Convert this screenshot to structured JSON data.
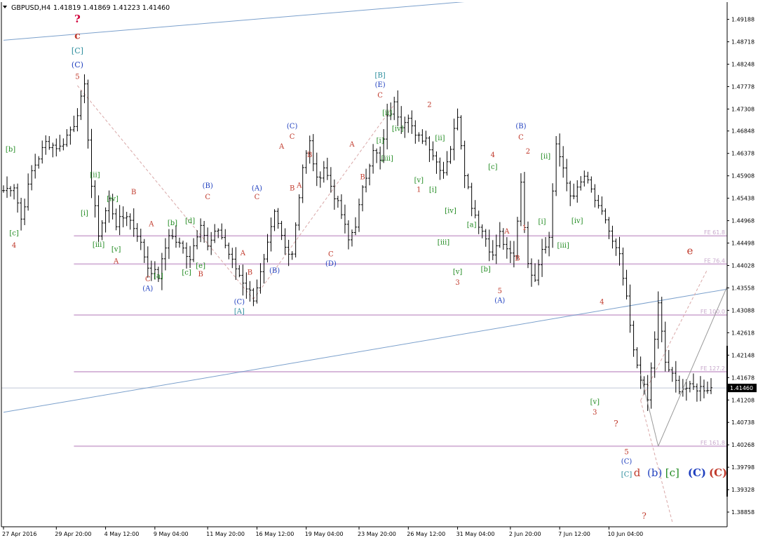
{
  "colors": {
    "background": "#ffffff",
    "bars": "#000000",
    "fib_lines": "#d7b8da",
    "fib_label": "#c8a9cc",
    "channel": "#7ba0cc",
    "red": "#c0392b",
    "magenta": "#d0003a",
    "green": "#228b22",
    "teal": "#2a8c9c",
    "blue": "#1f3fbf",
    "price_tag_bg": "#000000",
    "price_tag_text": "#ffffff",
    "dashed": "#d9a8a8",
    "projection": "#999999"
  },
  "chart_data": {
    "type": "ohlc",
    "header": {
      "symbol": "GBPUSD,H4",
      "ohlc": "1.41819 1.41869 1.41223 1.41460"
    },
    "ylim": [
      1.3855,
      1.4955
    ],
    "bar_count": 202,
    "x_tick_labels": [
      {
        "index": 0,
        "label": "27 Apr 2016"
      },
      {
        "index": 15,
        "label": "29 Apr 20:00"
      },
      {
        "index": 29,
        "label": "4 May 12:00"
      },
      {
        "index": 43,
        "label": "9 May 04:00"
      },
      {
        "index": 58,
        "label": "11 May 20:00"
      },
      {
        "index": 72,
        "label": "16 May 12:00"
      },
      {
        "index": 86,
        "label": "19 May 04:00"
      },
      {
        "index": 101,
        "label": "23 May 20:00"
      },
      {
        "index": 115,
        "label": "26 May 12:00"
      },
      {
        "index": 129,
        "label": "31 May 04:00"
      },
      {
        "index": 144,
        "label": "2 Jun 20:00"
      },
      {
        "index": 158,
        "label": "7 Jun 12:00"
      },
      {
        "index": 172,
        "label": "10 Jun 04:00"
      }
    ],
    "y_tick_labels": [
      "1.49188",
      "1.48718",
      "1.48248",
      "1.47778",
      "1.47308",
      "1.46848",
      "1.46378",
      "1.45908",
      "1.45438",
      "1.44968",
      "1.44498",
      "1.44028",
      "1.43558",
      "1.43088",
      "1.42618",
      "1.42148",
      "1.41678",
      "1.41208",
      "1.40738",
      "1.40268",
      "1.39798",
      "1.39328",
      "1.38858"
    ],
    "current_price": {
      "label": "1.41460",
      "value": 1.4146
    },
    "fib_levels": [
      {
        "label": "FE 61.8",
        "value": 1.4465
      },
      {
        "label": "FE 76.4",
        "value": 1.4406
      },
      {
        "label": "FE 100.0",
        "value": 1.4299
      },
      {
        "label": "FE 127.2",
        "value": 1.418
      },
      {
        "label": "FE 161.8",
        "value": 1.4024
      }
    ],
    "channel_lines": [
      {
        "from": [
          0,
          1.4875
        ],
        "to": [
          219,
          1.501
        ]
      },
      {
        "from": [
          0,
          1.4095
        ],
        "to": [
          219,
          1.437
        ]
      }
    ],
    "dashed_lines": [
      {
        "from": [
          21,
          1.478
        ],
        "to": [
          71,
          1.4332
        ]
      },
      {
        "from": [
          71,
          1.4332
        ],
        "to": [
          111,
          1.474
        ]
      },
      {
        "from": [
          181,
          1.412
        ],
        "to": [
          190,
          1.3865
        ]
      },
      {
        "from": [
          181,
          1.412
        ],
        "to": [
          200,
          1.4395
        ]
      }
    ],
    "projection_lines": [
      {
        "from": [
          181,
          1.4175
        ],
        "to": [
          186,
          1.4024
        ]
      },
      {
        "from": [
          186,
          1.4024
        ],
        "to": [
          208,
          1.44
        ]
      }
    ],
    "waypoints": [
      [
        0,
        1.456
      ],
      [
        3,
        1.457
      ],
      [
        5,
        1.45
      ],
      [
        8,
        1.46
      ],
      [
        12,
        1.466
      ],
      [
        16,
        1.465
      ],
      [
        20,
        1.47
      ],
      [
        23,
        1.4775
      ],
      [
        25,
        1.457
      ],
      [
        27,
        1.447
      ],
      [
        30,
        1.454
      ],
      [
        32,
        1.449
      ],
      [
        35,
        1.451
      ],
      [
        38,
        1.447
      ],
      [
        41,
        1.44
      ],
      [
        44,
        1.438
      ],
      [
        47,
        1.447
      ],
      [
        50,
        1.4445
      ],
      [
        53,
        1.442
      ],
      [
        56,
        1.4495
      ],
      [
        58,
        1.444
      ],
      [
        61,
        1.448
      ],
      [
        65,
        1.441
      ],
      [
        68,
        1.437
      ],
      [
        71,
        1.4335
      ],
      [
        74,
        1.441
      ],
      [
        77,
        1.451
      ],
      [
        80,
        1.444
      ],
      [
        82,
        1.443
      ],
      [
        85,
        1.461
      ],
      [
        87,
        1.466
      ],
      [
        89,
        1.458
      ],
      [
        91,
        1.461
      ],
      [
        93,
        1.457
      ],
      [
        96,
        1.451
      ],
      [
        98,
        1.4455
      ],
      [
        100,
        1.449
      ],
      [
        102,
        1.456
      ],
      [
        105,
        1.465
      ],
      [
        107,
        1.462
      ],
      [
        109,
        1.471
      ],
      [
        111,
        1.474
      ],
      [
        113,
        1.47
      ],
      [
        115,
        1.472
      ],
      [
        117,
        1.467
      ],
      [
        120,
        1.467
      ],
      [
        123,
        1.462
      ],
      [
        125,
        1.46
      ],
      [
        127,
        1.465
      ],
      [
        129,
        1.472
      ],
      [
        131,
        1.46
      ],
      [
        133,
        1.453
      ],
      [
        135,
        1.449
      ],
      [
        137,
        1.446
      ],
      [
        139,
        1.442
      ],
      [
        141,
        1.447
      ],
      [
        143,
        1.443
      ],
      [
        145,
        1.442
      ],
      [
        147,
        1.458
      ],
      [
        149,
        1.44
      ],
      [
        151,
        1.438
      ],
      [
        153,
        1.444
      ],
      [
        155,
        1.446
      ],
      [
        157,
        1.466
      ],
      [
        159,
        1.46
      ],
      [
        161,
        1.455
      ],
      [
        163,
        1.456
      ],
      [
        165,
        1.459
      ],
      [
        167,
        1.456
      ],
      [
        169,
        1.452
      ],
      [
        171,
        1.45
      ],
      [
        173,
        1.445
      ],
      [
        175,
        1.442
      ],
      [
        177,
        1.433
      ],
      [
        179,
        1.422
      ],
      [
        181,
        1.417
      ],
      [
        183,
        1.412
      ],
      [
        185,
        1.425
      ],
      [
        186,
        1.432
      ],
      [
        188,
        1.42
      ],
      [
        190,
        1.417
      ],
      [
        192,
        1.4146
      ]
    ],
    "wave_labels": [
      {
        "text": "?",
        "color": "magenta",
        "x": 21,
        "y": 1.4912,
        "size": 15,
        "bold": true
      },
      {
        "text": "c",
        "color": "red",
        "x": 21,
        "y": 1.4878,
        "size": 14,
        "bold": true
      },
      {
        "text": "[C]",
        "color": "teal",
        "x": 21,
        "y": 1.4848,
        "size": 11
      },
      {
        "text": "(C)",
        "color": "blue",
        "x": 21,
        "y": 1.4818,
        "size": 11
      },
      {
        "text": "5",
        "color": "red",
        "x": 21,
        "y": 1.4794,
        "size": 10
      },
      {
        "text": "[b]",
        "color": "green",
        "x": 2,
        "y": 1.4642,
        "size": 10
      },
      {
        "text": "[c]",
        "color": "green",
        "x": 3,
        "y": 1.4466,
        "size": 10
      },
      {
        "text": "4",
        "color": "red",
        "x": 3,
        "y": 1.444,
        "size": 10
      },
      {
        "text": "[ii]",
        "color": "green",
        "x": 26,
        "y": 1.4588,
        "size": 10
      },
      {
        "text": "[iv]",
        "color": "green",
        "x": 31,
        "y": 1.4538,
        "size": 10
      },
      {
        "text": "[i]",
        "color": "green",
        "x": 23,
        "y": 1.4508,
        "size": 10
      },
      {
        "text": "[iii]",
        "color": "green",
        "x": 27,
        "y": 1.4442,
        "size": 10
      },
      {
        "text": "[v]",
        "color": "green",
        "x": 32,
        "y": 1.4432,
        "size": 10
      },
      {
        "text": "A",
        "color": "red",
        "x": 32,
        "y": 1.4407,
        "size": 10
      },
      {
        "text": "B",
        "color": "red",
        "x": 37,
        "y": 1.4552,
        "size": 10
      },
      {
        "text": "A",
        "color": "red",
        "x": 42,
        "y": 1.4485,
        "size": 10
      },
      {
        "text": "C",
        "color": "red",
        "x": 41,
        "y": 1.437,
        "size": 10
      },
      {
        "text": "(A)",
        "color": "blue",
        "x": 41,
        "y": 1.435,
        "size": 10
      },
      {
        "text": "[a]",
        "color": "green",
        "x": 44,
        "y": 1.4376,
        "size": 10
      },
      {
        "text": "[b]",
        "color": "green",
        "x": 48,
        "y": 1.4487,
        "size": 10
      },
      {
        "text": "[d]",
        "color": "green",
        "x": 53,
        "y": 1.4492,
        "size": 10
      },
      {
        "text": "[c]",
        "color": "green",
        "x": 52,
        "y": 1.4384,
        "size": 10
      },
      {
        "text": "[e]",
        "color": "green",
        "x": 56,
        "y": 1.4398,
        "size": 10
      },
      {
        "text": "B",
        "color": "red",
        "x": 56,
        "y": 1.438,
        "size": 10
      },
      {
        "text": "(B)",
        "color": "blue",
        "x": 58,
        "y": 1.4565,
        "size": 10
      },
      {
        "text": "C",
        "color": "red",
        "x": 58,
        "y": 1.4542,
        "size": 10
      },
      {
        "text": "A",
        "color": "red",
        "x": 68,
        "y": 1.4424,
        "size": 10
      },
      {
        "text": "B",
        "color": "red",
        "x": 70,
        "y": 1.4384,
        "size": 10
      },
      {
        "text": "(C)",
        "color": "blue",
        "x": 67,
        "y": 1.4322,
        "size": 10
      },
      {
        "text": "[A]",
        "color": "teal",
        "x": 67,
        "y": 1.4302,
        "size": 10
      },
      {
        "text": "(A)",
        "color": "blue",
        "x": 72,
        "y": 1.456,
        "size": 10
      },
      {
        "text": "C",
        "color": "red",
        "x": 72,
        "y": 1.4542,
        "size": 10
      },
      {
        "text": "(B)",
        "color": "blue",
        "x": 77,
        "y": 1.4387,
        "size": 10
      },
      {
        "text": "(C)",
        "color": "blue",
        "x": 82,
        "y": 1.469,
        "size": 10
      },
      {
        "text": "C",
        "color": "red",
        "x": 82,
        "y": 1.4668,
        "size": 10
      },
      {
        "text": "A",
        "color": "red",
        "x": 79,
        "y": 1.4648,
        "size": 10
      },
      {
        "text": "B",
        "color": "red",
        "x": 87,
        "y": 1.463,
        "size": 10
      },
      {
        "text": "B",
        "color": "red",
        "x": 82,
        "y": 1.456,
        "size": 10
      },
      {
        "text": "A",
        "color": "red",
        "x": 84,
        "y": 1.4566,
        "size": 10
      },
      {
        "text": "C",
        "color": "red",
        "x": 93,
        "y": 1.4422,
        "size": 10
      },
      {
        "text": "(D)",
        "color": "blue",
        "x": 93,
        "y": 1.4402,
        "size": 10
      },
      {
        "text": "A",
        "color": "red",
        "x": 99,
        "y": 1.4652,
        "size": 10
      },
      {
        "text": "B",
        "color": "red",
        "x": 102,
        "y": 1.4584,
        "size": 10
      },
      {
        "text": "[B]",
        "color": "teal",
        "x": 107,
        "y": 1.4797,
        "size": 10
      },
      {
        "text": "(E)",
        "color": "blue",
        "x": 107,
        "y": 1.4777,
        "size": 10
      },
      {
        "text": "C",
        "color": "red",
        "x": 107,
        "y": 1.4755,
        "size": 10
      },
      {
        "text": "[ii]",
        "color": "green",
        "x": 109,
        "y": 1.4718,
        "size": 10
      },
      {
        "text": "[iv]",
        "color": "green",
        "x": 112,
        "y": 1.4685,
        "size": 10
      },
      {
        "text": "[i]",
        "color": "green",
        "x": 107,
        "y": 1.466,
        "size": 10
      },
      {
        "text": "[iii]",
        "color": "green",
        "x": 109,
        "y": 1.4623,
        "size": 10
      },
      {
        "text": "2",
        "color": "red",
        "x": 121,
        "y": 1.4735,
        "size": 10
      },
      {
        "text": "[ii]",
        "color": "green",
        "x": 124,
        "y": 1.4665,
        "size": 10
      },
      {
        "text": "[v]",
        "color": "green",
        "x": 118,
        "y": 1.4577,
        "size": 10
      },
      {
        "text": "1",
        "color": "red",
        "x": 118,
        "y": 1.4557,
        "size": 10
      },
      {
        "text": "[i]",
        "color": "green",
        "x": 122,
        "y": 1.4557,
        "size": 10
      },
      {
        "text": "[iv]",
        "color": "green",
        "x": 127,
        "y": 1.4513,
        "size": 10
      },
      {
        "text": "[iii]",
        "color": "green",
        "x": 125,
        "y": 1.4447,
        "size": 10
      },
      {
        "text": "[v]",
        "color": "green",
        "x": 129,
        "y": 1.4385,
        "size": 10
      },
      {
        "text": "3",
        "color": "red",
        "x": 129,
        "y": 1.4362,
        "size": 10
      },
      {
        "text": "[a]",
        "color": "green",
        "x": 133,
        "y": 1.4484,
        "size": 10
      },
      {
        "text": "[b]",
        "color": "green",
        "x": 137,
        "y": 1.439,
        "size": 10
      },
      {
        "text": "4",
        "color": "red",
        "x": 139,
        "y": 1.463,
        "size": 10
      },
      {
        "text": "[c]",
        "color": "green",
        "x": 139,
        "y": 1.4605,
        "size": 10
      },
      {
        "text": "A",
        "color": "red",
        "x": 143,
        "y": 1.447,
        "size": 10
      },
      {
        "text": "5",
        "color": "red",
        "x": 141,
        "y": 1.4345,
        "size": 10
      },
      {
        "text": "(A)",
        "color": "blue",
        "x": 141,
        "y": 1.4325,
        "size": 10
      },
      {
        "text": "B",
        "color": "red",
        "x": 146,
        "y": 1.4413,
        "size": 10
      },
      {
        "text": "1",
        "color": "red",
        "x": 148,
        "y": 1.4477,
        "size": 10
      },
      {
        "text": "(B)",
        "color": "blue",
        "x": 147,
        "y": 1.469,
        "size": 10
      },
      {
        "text": "C",
        "color": "red",
        "x": 147,
        "y": 1.4667,
        "size": 10
      },
      {
        "text": "2",
        "color": "red",
        "x": 149,
        "y": 1.4637,
        "size": 10
      },
      {
        "text": "[ii]",
        "color": "green",
        "x": 154,
        "y": 1.4627,
        "size": 10
      },
      {
        "text": "[i]",
        "color": "green",
        "x": 153,
        "y": 1.449,
        "size": 10
      },
      {
        "text": "[iv]",
        "color": "green",
        "x": 163,
        "y": 1.4492,
        "size": 10
      },
      {
        "text": "[iii]",
        "color": "green",
        "x": 159,
        "y": 1.444,
        "size": 10
      },
      {
        "text": "4",
        "color": "red",
        "x": 170,
        "y": 1.4322,
        "size": 10
      },
      {
        "text": "[v]",
        "color": "green",
        "x": 168,
        "y": 1.4112,
        "size": 10
      },
      {
        "text": "3",
        "color": "red",
        "x": 168,
        "y": 1.409,
        "size": 10
      },
      {
        "text": "?",
        "color": "red",
        "x": 174,
        "y": 1.4065,
        "size": 12
      },
      {
        "text": "5",
        "color": "red",
        "x": 177,
        "y": 1.4007,
        "size": 10
      },
      {
        "text": "(C)",
        "color": "blue",
        "x": 177,
        "y": 1.3987,
        "size": 10
      },
      {
        "text": "[C]",
        "color": "teal",
        "x": 177,
        "y": 1.396,
        "size": 10
      },
      {
        "text": "d",
        "color": "red",
        "x": 180,
        "y": 1.3961,
        "size": 15
      },
      {
        "text": "(b)",
        "color": "blue",
        "x": 185,
        "y": 1.3961,
        "size": 15
      },
      {
        "text": "[c]",
        "color": "green",
        "x": 190,
        "y": 1.3961,
        "size": 15
      },
      {
        "text": "(C)",
        "color": "blue",
        "x": 197,
        "y": 1.3961,
        "size": 15,
        "bold": true
      },
      {
        "text": "(C)",
        "color": "red",
        "x": 203,
        "y": 1.3961,
        "size": 15,
        "bold": true
      },
      {
        "text": "e",
        "color": "red",
        "x": 195,
        "y": 1.4426,
        "size": 15
      },
      {
        "text": "?",
        "color": "red",
        "x": 182,
        "y": 1.3872,
        "size": 12
      }
    ]
  }
}
